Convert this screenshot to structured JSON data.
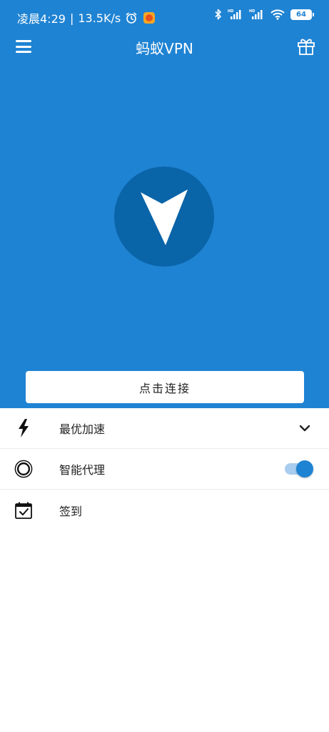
{
  "status_bar": {
    "time": "凌晨4:29",
    "separator": "|",
    "network_speed": "13.5K/s",
    "battery": "64",
    "hd_label": "HD"
  },
  "app_bar": {
    "title": "蚂蚁VPN"
  },
  "main": {
    "connect_button_label": "点击连接"
  },
  "settings": [
    {
      "label": "最优加速",
      "icon": "lightning-icon",
      "control": "chevron-down"
    },
    {
      "label": "智能代理",
      "icon": "ring-icon",
      "control": "toggle",
      "toggle_on": true
    },
    {
      "label": "签到",
      "icon": "calendar-check-icon",
      "control": "none"
    }
  ],
  "colors": {
    "primary": "#1f83d3",
    "logo_circle": "#0a64a8",
    "toggle_track": "#a8cdef"
  }
}
